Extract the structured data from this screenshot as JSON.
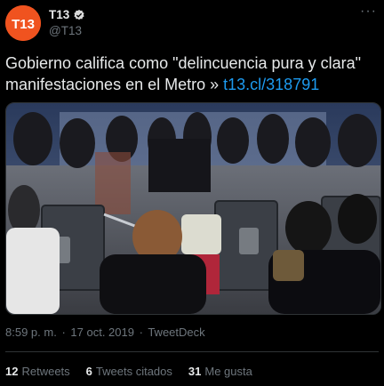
{
  "colors": {
    "background": "#000000",
    "accent": "#1d9bf0",
    "avatar_bg": "#f0531f",
    "muted": "#6e767d"
  },
  "author": {
    "avatar_text": "T13",
    "display_name": "T13",
    "handle": "@T13",
    "verified_icon": "verified-badge-icon"
  },
  "more_icon": "more-options-icon",
  "tweet": {
    "text": "Gobierno califica como \"delincuencia pura y clara\" manifestaciones en el Metro » ",
    "link": "t13.cl/318791"
  },
  "meta": {
    "time": "8:59 p. m.",
    "sep": "·",
    "date": "17 oct. 2019",
    "source": "TweetDeck"
  },
  "stats": [
    {
      "count": "12",
      "label": "Retweets"
    },
    {
      "count": "6",
      "label": "Tweets citados"
    },
    {
      "count": "31",
      "label": "Me gusta"
    }
  ]
}
